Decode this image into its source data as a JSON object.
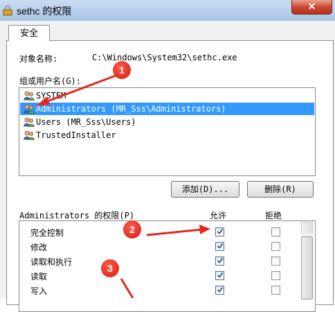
{
  "window": {
    "title": "sethc 的权限",
    "close_label": "✕"
  },
  "tabs": [
    {
      "label": "安全"
    }
  ],
  "object": {
    "label": "对象名称:",
    "value": "C:\\Windows\\System32\\sethc.exe"
  },
  "groups": {
    "label": "组或用户名(G):",
    "items": [
      {
        "label": "SYSTEM",
        "icon": "users-icon"
      },
      {
        "label": "Administrators (MR_Sss\\Administrators)",
        "icon": "users-icon",
        "selected": true
      },
      {
        "label": "Users (MR_Sss\\Users)",
        "icon": "users-icon"
      },
      {
        "label": "TrustedInstaller",
        "icon": "users-icon"
      }
    ]
  },
  "buttons": {
    "add": "添加(D)...",
    "remove": "删除(R)"
  },
  "permissions": {
    "header": "Administrators 的权限(P)",
    "allow_header": "允许",
    "deny_header": "拒绝",
    "rows": [
      {
        "name": "完全控制",
        "allow": true,
        "deny": false
      },
      {
        "name": "修改",
        "allow": true,
        "deny": false
      },
      {
        "name": "读取和执行",
        "allow": true,
        "deny": false
      },
      {
        "name": "读取",
        "allow": true,
        "deny": false
      },
      {
        "name": "写入",
        "allow": true,
        "deny": false
      }
    ]
  },
  "annotations": {
    "badge1": "1",
    "badge2": "2",
    "badge3": "3",
    "color": "#e02a1c"
  },
  "colors": {
    "selection": "#3399ff",
    "close": "#c7432d"
  }
}
